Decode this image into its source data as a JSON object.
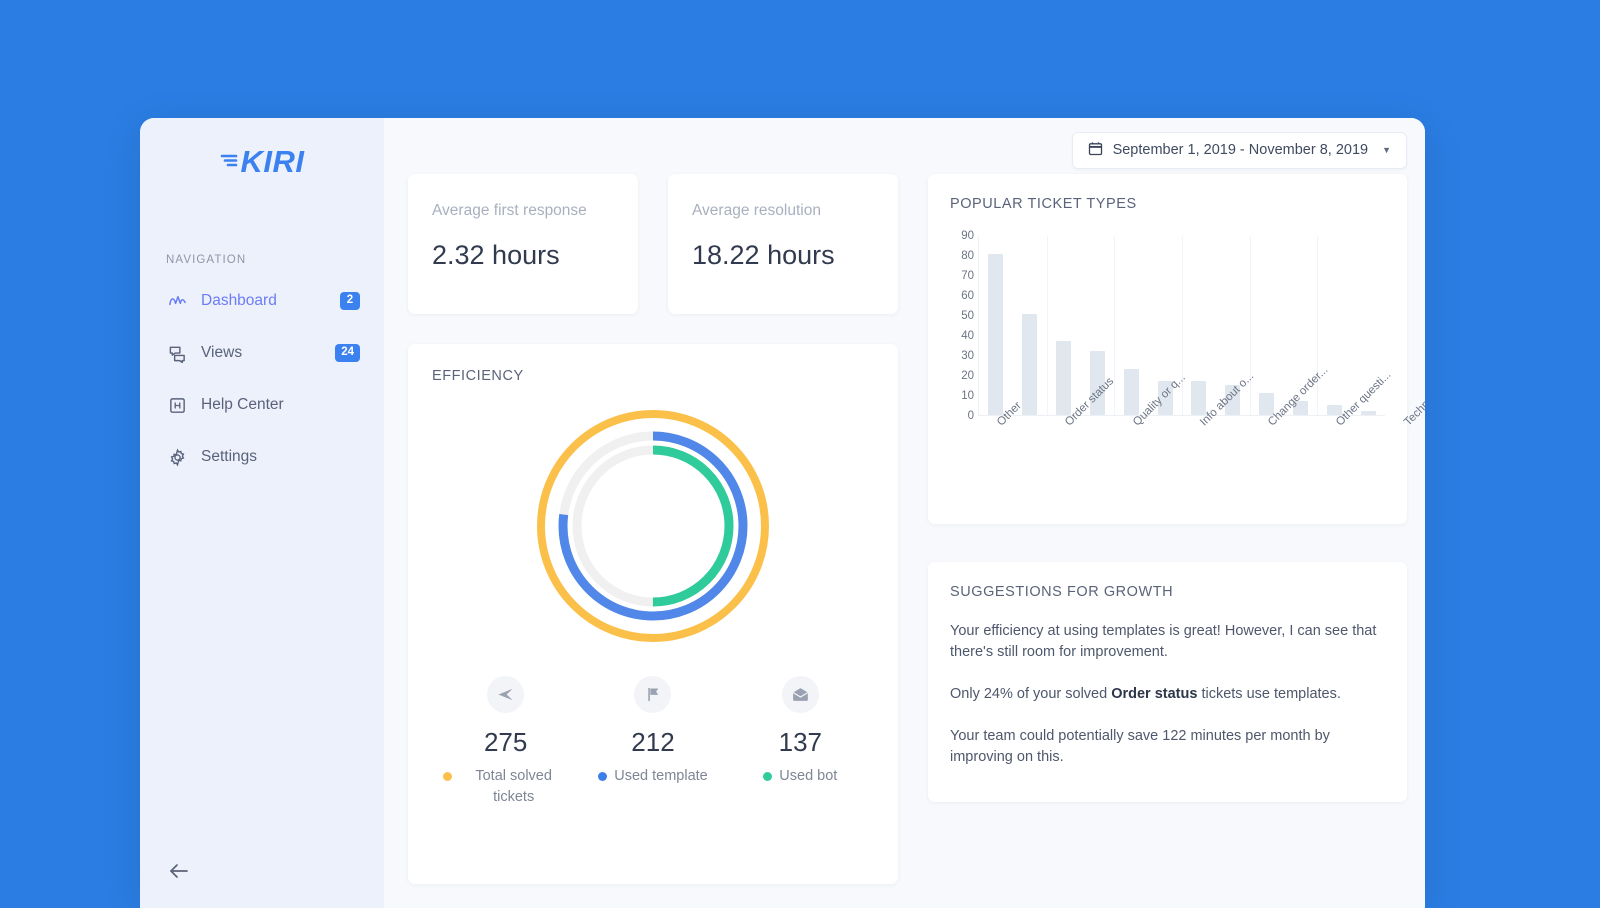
{
  "app": {
    "logo_text": "KIRI",
    "logo_icon": "kiri-lines-icon"
  },
  "sidebar": {
    "section_label": "NAVIGATION",
    "collapse_icon": "arrow-left-icon",
    "items": [
      {
        "label": "Dashboard",
        "badge": "2",
        "icon": "activity-chart-icon",
        "active": true
      },
      {
        "label": "Views",
        "badge": "24",
        "icon": "speech-bubbles-icon",
        "active": false
      },
      {
        "label": "Help Center",
        "badge": "",
        "icon": "help-box-icon",
        "active": false
      },
      {
        "label": "Settings",
        "badge": "",
        "icon": "gear-icon",
        "active": false
      }
    ]
  },
  "topbar": {
    "date_range": "September 1, 2019 - November 8, 2019",
    "calendar_icon": "calendar-icon",
    "caret_icon": "caret-down-icon"
  },
  "kpis": [
    {
      "label": "Average first response",
      "value": "2.32 hours"
    },
    {
      "label": "Average resolution",
      "value": "18.22 hours"
    }
  ],
  "efficiency": {
    "title": "EFFICIENCY",
    "stats": [
      {
        "value": "275",
        "legend": "Total solved tickets",
        "color": "#FBC04A",
        "icon": "send-icon"
      },
      {
        "value": "212",
        "legend": "Used template",
        "color": "#3D7FE8",
        "icon": "flag-icon"
      },
      {
        "value": "137",
        "legend": "Used bot",
        "color": "#2FCB9B",
        "icon": "envelope-icon"
      }
    ]
  },
  "suggestions": {
    "title": "SUGGESTIONS FOR GROWTH",
    "p1": "Your efficiency at using templates is great! However, I can see that there's still room for improvement.",
    "p2_before": "Only 24% of your solved ",
    "p2_bold": "Order status",
    "p2_after": " tickets use templates.",
    "p3": "Your team could potentially save 122 minutes per month by improving on this."
  },
  "colors": {
    "page_background": "#2B7DE3",
    "sidebar_background": "#EDF1FB",
    "content_background": "#F7F9FC",
    "accent_blue": "#3B82F0",
    "nav_active": "#6A7DF4",
    "ring_total": "#FBC04A",
    "ring_template": "#5187E8",
    "ring_bot": "#2FCB9B",
    "ring_track": "#F0F0F0",
    "bar_fill": "#E0E7EF"
  },
  "chart_data": [
    {
      "type": "donut",
      "title": "EFFICIENCY",
      "rings": [
        {
          "name": "Total solved tickets",
          "value": 275,
          "percent": 100,
          "color": "#FBC04A"
        },
        {
          "name": "Used template",
          "value": 212,
          "percent": 77,
          "color": "#5187E8"
        },
        {
          "name": "Used bot",
          "value": 137,
          "percent": 50,
          "color": "#2FCB9B"
        }
      ],
      "total": 275,
      "legend_position": "bottom"
    },
    {
      "type": "bar",
      "title": "POPULAR TICKET TYPES",
      "categories": [
        "Other",
        "",
        "Order status",
        "",
        "Quality or q...",
        "",
        "Info about o...",
        "",
        "Change order...",
        "",
        "Other questi...",
        "",
        "Technical is..."
      ],
      "tick_labels": [
        "Other",
        "Order status",
        "Quality or q...",
        "Info about o...",
        "Change order...",
        "Other questi...",
        "Technical is..."
      ],
      "values": [
        81,
        51,
        37,
        32,
        23,
        17,
        17,
        15,
        11,
        7,
        5,
        2
      ],
      "yticks": [
        90,
        80,
        70,
        60,
        50,
        40,
        30,
        20,
        10,
        0
      ],
      "ylim": [
        0,
        90
      ],
      "xlabel": "",
      "ylabel": "",
      "grid": "vertical"
    }
  ]
}
